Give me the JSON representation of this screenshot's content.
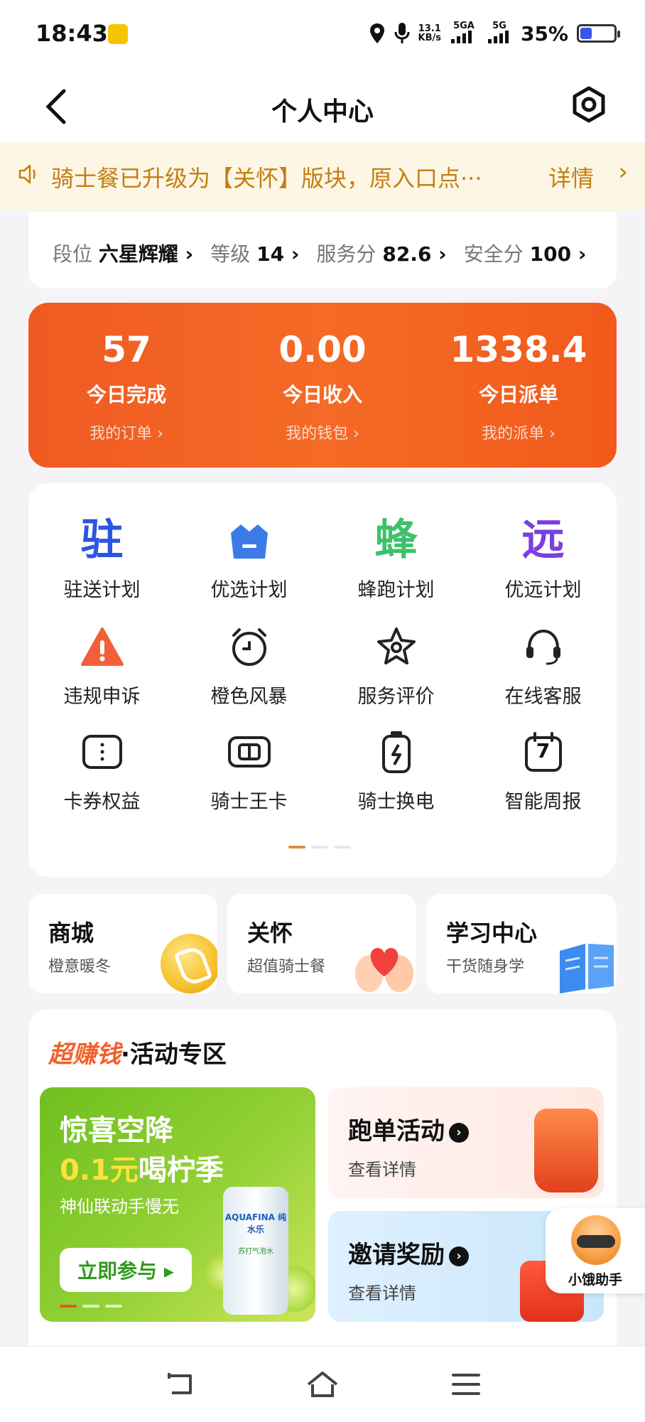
{
  "status_bar": {
    "time": "18:43",
    "net_speed_value": "13.1",
    "net_speed_unit": "KB/s",
    "sim1": "5GA",
    "sim2": "5G",
    "battery": "35%",
    "battery_level": 0.35
  },
  "header": {
    "title": "个人中心"
  },
  "notice": {
    "text": "骑士餐已升级为【关怀】版块，原入口点···",
    "link": "详情"
  },
  "rank": [
    {
      "label": "段位",
      "value": "六星辉耀"
    },
    {
      "label": "等级",
      "value": "14"
    },
    {
      "label": "服务分",
      "value": "82.6"
    },
    {
      "label": "安全分",
      "value": "100"
    }
  ],
  "today": [
    {
      "value": "57",
      "label": "今日完成",
      "link": "我的订单 ›"
    },
    {
      "value": "0.00",
      "label": "今日收入",
      "link": "我的钱包 ›"
    },
    {
      "value": "1338.4",
      "label": "今日派单",
      "link": "我的派单 ›"
    }
  ],
  "grid": [
    {
      "label": "驻送计划",
      "glyph": "驻",
      "color": "#2d56e0"
    },
    {
      "label": "优选计划",
      "glyph": "",
      "color": "#3a7be8"
    },
    {
      "label": "蜂跑计划",
      "glyph": "蜂",
      "color": "#3fc16c"
    },
    {
      "label": "优远计划",
      "glyph": "远",
      "color": "#7a3fe0"
    },
    {
      "label": "违规申诉",
      "glyph": "!",
      "color": "#f2603a"
    },
    {
      "label": "橙色风暴",
      "glyph": "",
      "color": "#222"
    },
    {
      "label": "服务评价",
      "glyph": "",
      "color": "#222"
    },
    {
      "label": "在线客服",
      "glyph": "",
      "color": "#222"
    },
    {
      "label": "卡券权益",
      "glyph": "",
      "color": "#222"
    },
    {
      "label": "骑士王卡",
      "glyph": "",
      "color": "#222"
    },
    {
      "label": "骑士换电",
      "glyph": "",
      "color": "#222"
    },
    {
      "label": "智能周报",
      "glyph": "7",
      "color": "#222"
    }
  ],
  "shortcuts": [
    {
      "title": "商城",
      "sub": "橙意暖冬"
    },
    {
      "title": "关怀",
      "sub": "超值骑士餐"
    },
    {
      "title": "学习中心",
      "sub": "干货随身学"
    }
  ],
  "activity": {
    "title_highlight": "超赚钱",
    "title": "·活动专区",
    "promo": {
      "line1": "惊喜空降",
      "line2_yellow": "0.1元",
      "line2_rest": "喝柠季",
      "line3": "神仙联动手慢无",
      "button": "立即参与 ▸",
      "can_brand": "AQUAFINA 纯水乐",
      "can_sub": "苏打气泡水"
    },
    "cards": [
      {
        "title": "跑单活动",
        "sub": "查看详情"
      },
      {
        "title": "邀请奖励",
        "sub": "查看详情"
      }
    ]
  },
  "helper": {
    "label": "小饿助手"
  },
  "colors": {
    "accent": "#f05a22",
    "notice": "#c47f12",
    "promo": "#93d136"
  }
}
